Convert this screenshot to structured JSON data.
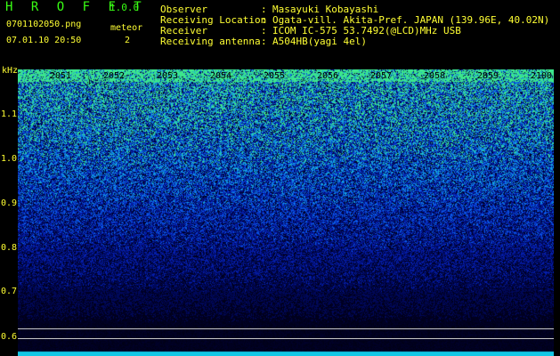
{
  "app": {
    "logo": "H R O F F T",
    "version": "1.0.0"
  },
  "file": {
    "name": "0701102050.png",
    "datetime": "07.01.10 20:50"
  },
  "meteor": {
    "label": "meteor",
    "count": "2"
  },
  "info": [
    {
      "label": "Observer",
      "value": "Masayuki Kobayashi"
    },
    {
      "label": "Receiving Location",
      "value": "Ogata-vill. Akita-Pref. JAPAN (139.96E, 40.02N)"
    },
    {
      "label": "Receiver",
      "value": "ICOM IC-575 53.7492(@LCD)MHz USB"
    },
    {
      "label": "Receiving antenna",
      "value": "A504HB(yagi 4el)"
    }
  ],
  "info_separator": ":",
  "axis": {
    "y_unit": "kHz",
    "x_ticks": [
      "2051",
      "2052",
      "2053",
      "2054",
      "2055",
      "2056",
      "2057",
      "2058",
      "2059",
      "2100"
    ],
    "y_ticks": [
      "1.1",
      "1.0",
      "0.9",
      "0.8",
      "0.7",
      "0.6"
    ],
    "y_range": [
      0.57,
      1.2
    ]
  },
  "colors": {
    "logo": "#39ff14",
    "text": "#ffff33",
    "background": "#000000",
    "spectrogram_low": "#000033",
    "spectrogram_high": "#33ff99"
  }
}
